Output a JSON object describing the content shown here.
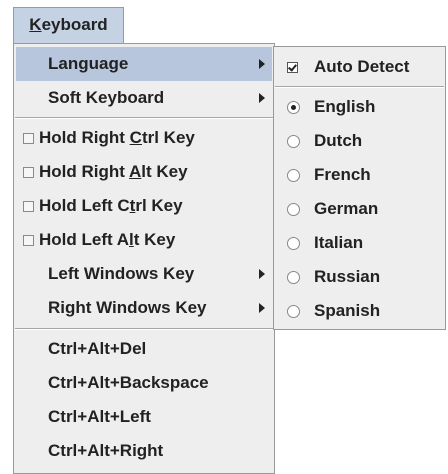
{
  "menubar": {
    "title_mnemonic": "K",
    "title_rest": "eyboard"
  },
  "menu": {
    "language": "Language",
    "soft_keyboard": "Soft Keyboard",
    "hold_right_ctrl_a": "Hold Right ",
    "hold_right_ctrl_m": "C",
    "hold_right_ctrl_b": "trl Key",
    "hold_right_alt_a": "Hold Right ",
    "hold_right_alt_m": "A",
    "hold_right_alt_b": "lt Key",
    "hold_left_ctrl_a": "Hold Left C",
    "hold_left_ctrl_m": "t",
    "hold_left_ctrl_b": "rl Key",
    "hold_left_alt_a": "Hold Left A",
    "hold_left_alt_m": "l",
    "hold_left_alt_b": "t Key",
    "left_windows_key": "Left Windows Key",
    "right_windows_key": "Right Windows Key",
    "ctrl_alt_del": "Ctrl+Alt+Del",
    "ctrl_alt_backspace": "Ctrl+Alt+Backspace",
    "ctrl_alt_left": "Ctrl+Alt+Left",
    "ctrl_alt_right": "Ctrl+Alt+Right"
  },
  "language_submenu": {
    "auto_detect": "Auto Detect",
    "options": [
      "English",
      "Dutch",
      "French",
      "German",
      "Italian",
      "Russian",
      "Spanish"
    ],
    "selected": "English"
  },
  "colors": {
    "menu_background": "#eeeeee",
    "selection": "#b7c6dd",
    "menubar_selection": "#c5d2e4"
  }
}
